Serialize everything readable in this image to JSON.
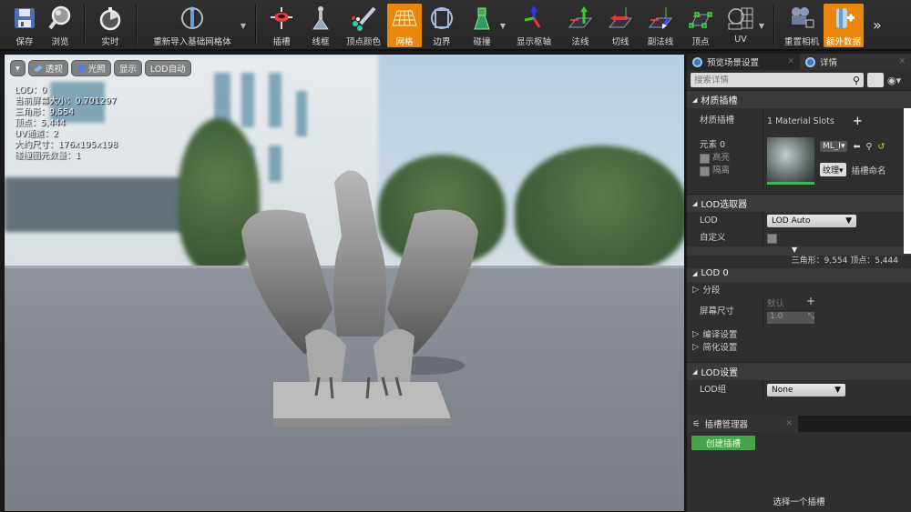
{
  "toolbar": {
    "buttons": [
      {
        "id": "save",
        "label": "保存",
        "icon": "floppy-disk-icon"
      },
      {
        "id": "browse",
        "label": "浏览",
        "icon": "magnifier-icon"
      },
      {
        "id": "realtime",
        "label": "实时",
        "icon": "stopwatch-icon"
      },
      {
        "id": "reimport",
        "label": "重新导入基础网格体",
        "icon": "reimport-mannequin-icon"
      },
      {
        "id": "sockets",
        "label": "插槽",
        "icon": "socket-icon"
      },
      {
        "id": "wireframe",
        "label": "线框",
        "icon": "wireframe-icon"
      },
      {
        "id": "vertex-colors",
        "label": "顶点颜色",
        "icon": "vertex-color-icon"
      },
      {
        "id": "grid",
        "label": "网格",
        "icon": "grid-icon",
        "active": true
      },
      {
        "id": "bounds",
        "label": "边界",
        "icon": "bounds-icon"
      },
      {
        "id": "collision",
        "label": "碰撞",
        "icon": "collision-icon"
      },
      {
        "id": "pivot",
        "label": "显示枢轴",
        "icon": "pivot-axis-icon"
      },
      {
        "id": "normals",
        "label": "法线",
        "icon": "normals-icon"
      },
      {
        "id": "tangents",
        "label": "切线",
        "icon": "tangents-icon"
      },
      {
        "id": "binormals",
        "label": "副法线",
        "icon": "binormals-icon"
      },
      {
        "id": "vertices",
        "label": "顶点",
        "icon": "vertices-icon"
      },
      {
        "id": "uv",
        "label": "UV",
        "icon": "uv-icon"
      },
      {
        "id": "reset-camera",
        "label": "重置相机",
        "icon": "camera-icon"
      },
      {
        "id": "additional-data",
        "label": "额外数据",
        "icon": "additional-data-icon",
        "active": true
      }
    ],
    "more_icon": "»"
  },
  "viewport": {
    "buttons": {
      "menu": "▾",
      "perspective": "透视",
      "lit": "光照",
      "show": "显示",
      "lod": "LOD自动"
    },
    "stats": [
      "LOD：0",
      "当前屏幕大小：0.701297",
      "三角形：9,554",
      "顶点：5,444",
      "UV通道：2",
      "大约尺寸：176x195x198",
      "碰撞图元数量：1"
    ]
  },
  "panel": {
    "tabs": [
      {
        "label": "预览场景设置"
      },
      {
        "label": "详情"
      }
    ],
    "search_placeholder": "搜索详情",
    "material_slots": {
      "header": "材质插槽",
      "row_label": "材质插槽",
      "count_text": "1 Material Slots",
      "add": "+",
      "element_label": "元素 0",
      "highlight": "高亮",
      "isolate": "隔离",
      "material_name": "ML_I",
      "texture_dd": "纹理",
      "slot_name": "插槽命名"
    },
    "lod_picker": {
      "header": "LOD选取器",
      "lod_label": "LOD",
      "lod_value": "LOD Auto",
      "custom_label": "自定义",
      "summary": "三角形：9,554    顶点：5,444"
    },
    "lod0": {
      "header": "LOD 0",
      "sections": "分段",
      "screen_size_label": "屏幕尺寸",
      "default_label": "默认",
      "screen_size_value": "1.0",
      "build_settings": "编译设置",
      "reduction_settings": "简化设置"
    },
    "lod_settings": {
      "header": "LOD设置",
      "lod_group_label": "LOD组",
      "lod_group_value": "None"
    }
  },
  "socket_manager": {
    "tab": "插槽管理器",
    "create_button": "创建插槽",
    "hint": "选择一个插槽"
  }
}
